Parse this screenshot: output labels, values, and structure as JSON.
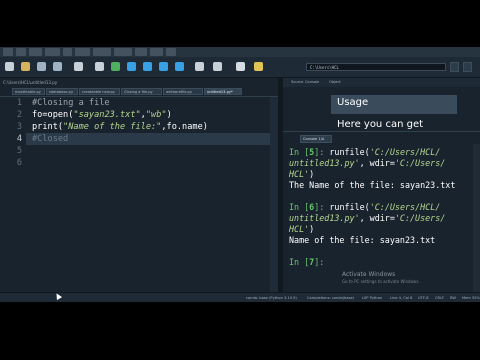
{
  "window": {
    "path": "C:\\Users\\HCL\\untitled13.py"
  },
  "toolbar": {
    "working_dir": "C:\\Users\\HCL",
    "icons": [
      "new-file-icon",
      "open-file-icon",
      "save-icon",
      "save-all-icon",
      "new-window-icon",
      "run-file-icon",
      "run-cell-icon",
      "run-cell-advance-icon",
      "run-selection-icon",
      "step-icon",
      "debug-icon",
      "continue-icon",
      "stop-icon",
      "wrench-icon",
      "python-path-icon"
    ],
    "accent": "#3aa0e6"
  },
  "editor": {
    "tabs": [
      {
        "label": "mosthtable.py"
      },
      {
        "label": "sdatabase.py"
      },
      {
        "label": "createable new.py"
      },
      {
        "label": "Closing a file.py"
      },
      {
        "label": "writeprefile.py"
      },
      {
        "label": "untitled13.py*"
      }
    ],
    "lines": [
      {
        "n": "1",
        "tokens": [
          {
            "t": "#Closing a file",
            "c": "comment"
          }
        ]
      },
      {
        "n": "2",
        "tokens": [
          {
            "t": "fo=open(",
            "c": "plain"
          },
          {
            "t": "\"sayan23.txt\"",
            "c": "str"
          },
          {
            "t": ",",
            "c": "plain"
          },
          {
            "t": "\"wb\"",
            "c": "str"
          },
          {
            "t": ")",
            "c": "plain"
          }
        ]
      },
      {
        "n": "3",
        "tokens": [
          {
            "t": "print(",
            "c": "plain"
          },
          {
            "t": "\"Name of the file:\"",
            "c": "str"
          },
          {
            "t": ",fo.name)",
            "c": "plain"
          }
        ]
      },
      {
        "n": "4",
        "tokens": [
          {
            "t": "#Closed",
            "c": "dim"
          }
        ]
      },
      {
        "n": "5",
        "tokens": []
      },
      {
        "n": "6",
        "tokens": []
      }
    ],
    "current_line": "4"
  },
  "help": {
    "tabs": [
      "Source",
      "Console",
      "Object"
    ],
    "usage_title": "Usage",
    "usage_text": "Here you can get"
  },
  "console": {
    "tab_label": "Console 1/A",
    "entries": [
      {
        "prompt_pre": "In [",
        "num": "5",
        "prompt_post": "]: ",
        "cmd": "runfile(",
        "arg1": "'C:/Users/HCL/",
        "arg1b": "untitled13.py'",
        "rest": ", wdir=",
        "arg2": "'C:/Users/",
        "arg2b": "HCL'",
        "close": ")",
        "output": "The Name of the file: sayan23.txt"
      },
      {
        "prompt_pre": "In [",
        "num": "6",
        "prompt_post": "]: ",
        "cmd": "runfile(",
        "arg1": "'C:/Users/HCL/",
        "arg1b": "untitled13.py'",
        "rest": ", wdir=",
        "arg2": "'C:/Users/",
        "arg2b": "HCL'",
        "close": ")",
        "output": "Name of the file: sayan23.txt"
      }
    ],
    "next_prompt": {
      "pre": "In [",
      "num": "7",
      "post": "]:"
    }
  },
  "watermark": {
    "title": "Activate Windows",
    "subtitle": "Go to PC settings to activate Windows."
  },
  "statusbar": {
    "kernel": "conda: base (Python 3.10.9)",
    "completions": "Completions: conda(base)",
    "lsp": "LSP Python",
    "position": "Line 4, Col 8",
    "encoding": "UTF-8",
    "eol": "CRLF",
    "permissions": "RW",
    "memory": "Mem 55%"
  }
}
